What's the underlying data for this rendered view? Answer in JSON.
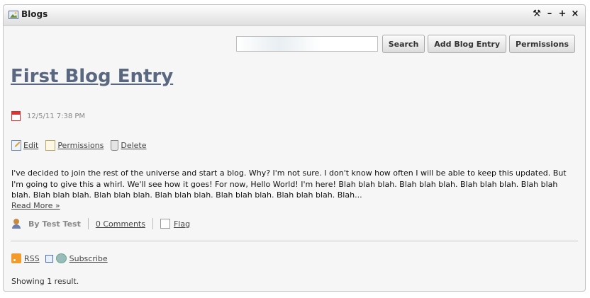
{
  "portlet": {
    "title": "Blogs",
    "actions": {
      "configure_icon": "wrench-icon",
      "minimize_icon": "minus-icon",
      "maximize_icon": "plus-icon",
      "close_icon": "close-icon",
      "configure_glyph": "⚒",
      "minimize_glyph": "–",
      "maximize_glyph": "+",
      "close_glyph": "×"
    }
  },
  "toolbar": {
    "search_value": "",
    "search_label": "Search",
    "add_label": "Add Blog Entry",
    "permissions_label": "Permissions"
  },
  "entry": {
    "title": "First Blog Entry",
    "date": "12/5/11 7:38 PM",
    "actions": {
      "edit": "Edit",
      "permissions": "Permissions",
      "delete": "Delete"
    },
    "body": "I've decided to join the rest of the universe and start a blog. Why? I'm not sure. I don't know how often I will be able to keep this updated. But I'm going to give this a whirl. We'll see how it goes! For now, Hello World! I'm here!   Blah blah blah. Blah blah blah. Blah blah blah. Blah blah blah. Blah blah blah. Blah blah blah. Blah blah blah. Blah blah blah. Blah blah blah. Blah...",
    "read_more": "Read More »",
    "author": "By Test Test",
    "comments": "0 Comments",
    "flag": "Flag"
  },
  "footer": {
    "rss": "RSS",
    "subscribe": "Subscribe",
    "results": "Showing 1 result."
  },
  "colors": {
    "title_link": "#5a6780",
    "panel_bg": "#f6f6f6"
  }
}
